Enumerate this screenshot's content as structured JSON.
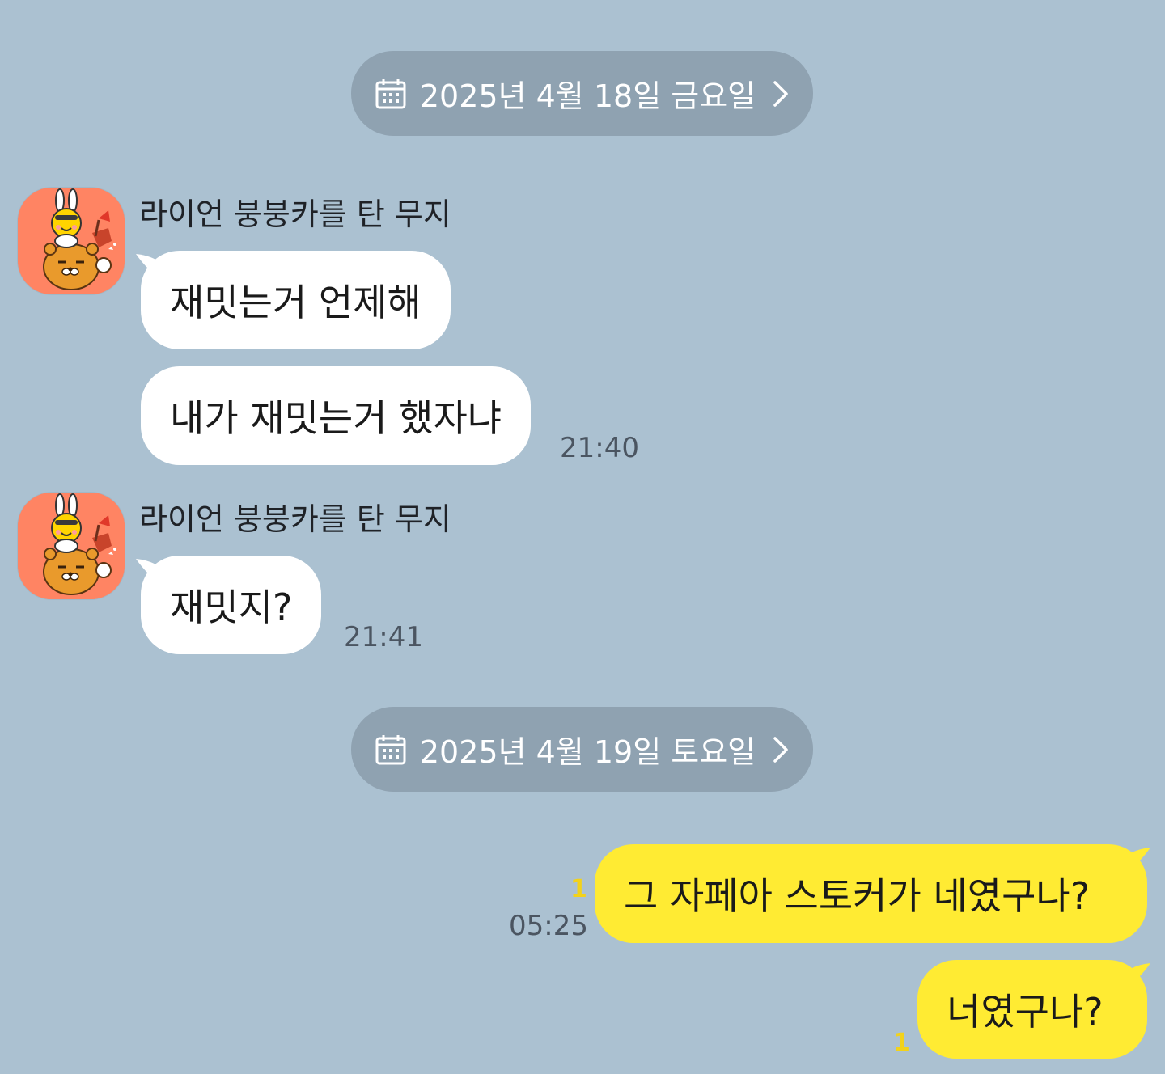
{
  "days": [
    {
      "date_label": "2025년 4월 18일 금요일"
    },
    {
      "date_label": "2025년 4월 19일 토요일"
    }
  ],
  "groups": [
    {
      "sender": "라이언 붕붕카를 탄 무지",
      "messages": [
        {
          "text": "재밋는거 언제해"
        },
        {
          "text": "내가 재밋는거 했자냐",
          "time": "21:40"
        }
      ]
    },
    {
      "sender": "라이언 붕붕카를 탄 무지",
      "messages": [
        {
          "text": "재밋지?",
          "time": "21:41"
        }
      ]
    }
  ],
  "outgoing": [
    {
      "text": "그 자페아 스토커가 네였구나?",
      "time": "05:25",
      "unread": "1"
    },
    {
      "text": "너였구나?",
      "unread": "1"
    }
  ],
  "icons": {
    "date": "calendar-icon",
    "more": "chevron-right-icon",
    "avatar": "muzi-riding-ryan-car-profile"
  },
  "colors": {
    "background": "#abc1d1",
    "incoming_bubble": "#ffffff",
    "outgoing_bubble": "#ffeb33",
    "date_pill": "#8fa2b1",
    "unread": "#f2d21a",
    "avatar_bg": "#ff8463"
  }
}
